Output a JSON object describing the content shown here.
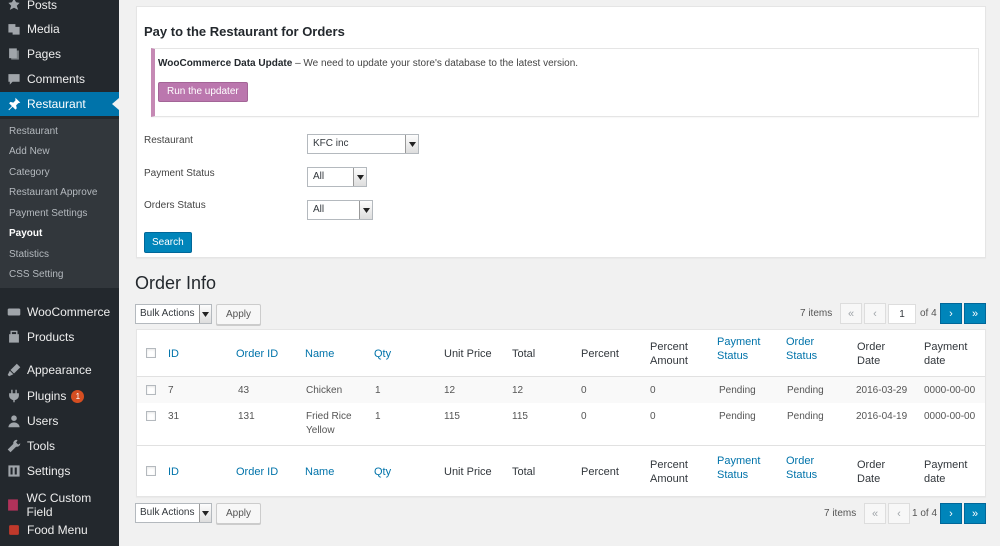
{
  "sidebar": {
    "menu": [
      {
        "label": "Posts",
        "icon": "pin-icon"
      },
      {
        "label": "Media",
        "icon": "media-icon"
      },
      {
        "label": "Pages",
        "icon": "pages-icon"
      },
      {
        "label": "Comments",
        "icon": "comments-icon"
      },
      {
        "label": "Restaurant",
        "icon": "pin-icon"
      }
    ],
    "submenu": [
      "Restaurant",
      "Add New",
      "Category",
      "Restaurant Approve",
      "Payment Settings",
      "Payout",
      "Statistics",
      "CSS Setting"
    ],
    "menu2": [
      {
        "label": "WooCommerce",
        "icon": "woocommerce-icon"
      },
      {
        "label": "Products",
        "icon": "products-icon"
      },
      {
        "label": "Appearance",
        "icon": "appearance-icon"
      },
      {
        "label": "Plugins",
        "icon": "plugins-icon",
        "badge": "1"
      },
      {
        "label": "Users",
        "icon": "users-icon"
      },
      {
        "label": "Tools",
        "icon": "tools-icon"
      },
      {
        "label": "Settings",
        "icon": "settings-icon"
      },
      {
        "label": "WC Custom Field",
        "icon": "custom-field-icon"
      },
      {
        "label": "Food Menu",
        "icon": "food-menu-icon"
      }
    ],
    "active_color": "#0073aa"
  },
  "pay": {
    "title": "Pay to the Restaurant for Orders",
    "notice_bold": "WooCommerce Data Update",
    "notice_text": " – We need to update your store's database to the latest version.",
    "updater_button": "Run the updater",
    "restaurant_label": "Restaurant",
    "restaurant_value": "KFC inc",
    "payment_status_label": "Payment Status",
    "payment_status_value": "All",
    "orders_status_label": "Orders Status",
    "orders_status_value": "All",
    "search_button": "Search"
  },
  "orders": {
    "heading": "Order Info",
    "bulk_actions": "Bulk Actions",
    "apply": "Apply",
    "items_count": "7 items",
    "pager_first": "«",
    "pager_prev": "‹",
    "pager_next": "›",
    "pager_last": "»",
    "current_page": "1",
    "of_pages_top": "of 4",
    "of_pages_bottom": "1 of 4",
    "columns": [
      "ID",
      "Order ID",
      "Name",
      "Qty",
      "Unit Price",
      "Total",
      "Percent",
      "Percent Amount",
      "Payment Status",
      "Order Status",
      "Order Date",
      "Payment date"
    ],
    "rows": [
      {
        "id": "7",
        "order_id": "43",
        "name": "Chicken",
        "qty": "1",
        "unit_price": "12",
        "total": "12",
        "percent": "0",
        "percent_amount": "0",
        "payment_status": "Pending",
        "order_status": "Pending",
        "order_date": "2016-03-29",
        "payment_date": "0000-00-00"
      },
      {
        "id": "31",
        "order_id": "131",
        "name": "Fried Rice Yellow",
        "qty": "1",
        "unit_price": "115",
        "total": "115",
        "percent": "0",
        "percent_amount": "0",
        "payment_status": "Pending",
        "order_status": "Pending",
        "order_date": "2016-04-19",
        "payment_date": "0000-00-00"
      }
    ]
  }
}
